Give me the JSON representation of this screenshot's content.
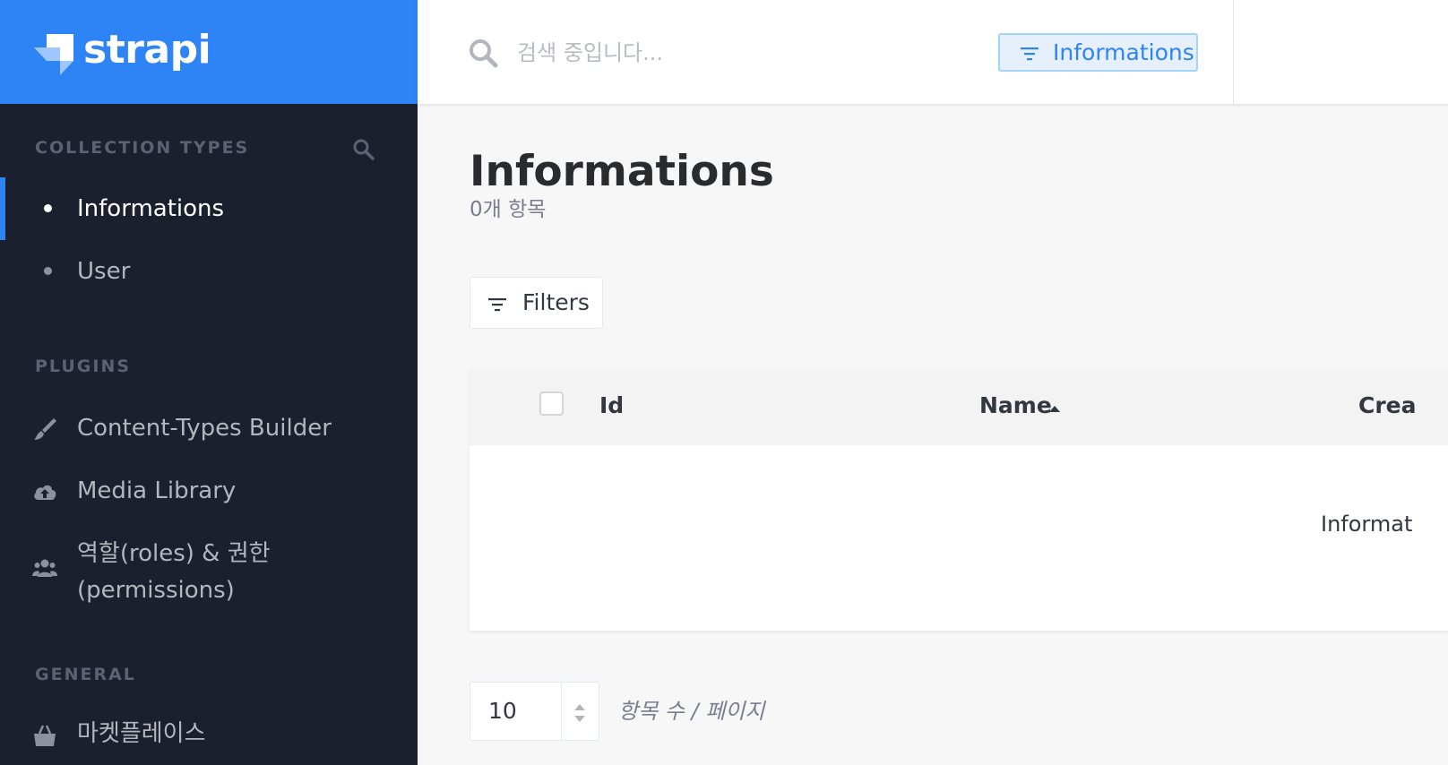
{
  "brand": {
    "name": "strapi"
  },
  "sidebar": {
    "collection_types": {
      "title": "COLLECTION TYPES",
      "items": [
        {
          "label": "Informations",
          "active": true
        },
        {
          "label": "User",
          "active": false
        }
      ]
    },
    "plugins": {
      "title": "PLUGINS",
      "items": [
        {
          "label": "Content-Types Builder",
          "icon": "paintbrush-icon"
        },
        {
          "label": "Media Library",
          "icon": "cloud-upload-icon"
        },
        {
          "label": "역할(roles) & 권한(permissions)",
          "icon": "users-icon"
        }
      ]
    },
    "general": {
      "title": "GENERAL",
      "items": [
        {
          "label": "마켓플레이스",
          "icon": "shopping-basket-icon"
        }
      ]
    }
  },
  "header": {
    "search_placeholder": "검색 중입니다...",
    "filter_tag": "Informations"
  },
  "main": {
    "title": "Informations",
    "count_text": "0개 항목",
    "filters_label": "Filters",
    "table": {
      "columns": [
        "Id",
        "Name",
        "Crea"
      ],
      "sorted_column": "Name",
      "empty_text": "Informat"
    },
    "pagination": {
      "per_page": "10",
      "caption": "항목 수 / 페이지"
    }
  },
  "colors": {
    "brand": "#2e84f5",
    "sidebar_bg": "#1b202e",
    "tag_bg": "#e6f0fd"
  }
}
